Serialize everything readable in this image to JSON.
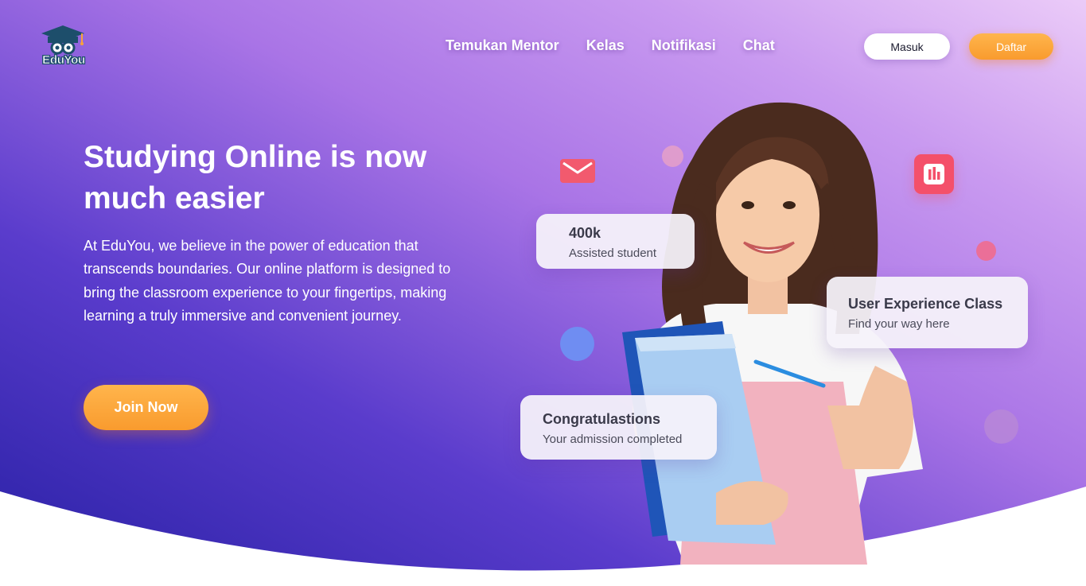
{
  "brand": {
    "name": "EduYou"
  },
  "nav": {
    "items": [
      "Temukan Mentor",
      "Kelas",
      "Notifikasi",
      "Chat"
    ],
    "login_label": "Masuk",
    "register_label": "Daftar"
  },
  "hero": {
    "title_line1": "Studying Online is now",
    "title_line2": "much easier",
    "description": "At EduYou, we believe in the power of education that transcends boundaries. Our online platform is designed to bring the classroom experience to your fingertips, making learning a truly immersive and convenient journey.",
    "cta_label": "Join Now"
  },
  "cards": {
    "stat": {
      "title": "400k",
      "subtitle": "Assisted student"
    },
    "ux_class": {
      "title": "User Experience Class",
      "subtitle": "Find your way here"
    },
    "congrats": {
      "title": "Congratulastions",
      "subtitle": "Your admission completed"
    }
  },
  "icons": {
    "logo": "graduation-owl-icon",
    "mail": "mail-icon",
    "chart": "bar-chart-icon"
  },
  "colors": {
    "hero_gradient_start": "#3323a8",
    "hero_gradient_mid": "#8b55e0",
    "hero_gradient_end": "#e6c4f7",
    "accent_orange": "#fca53c",
    "accent_pink": "#f4506a",
    "text_white": "#ffffff"
  }
}
